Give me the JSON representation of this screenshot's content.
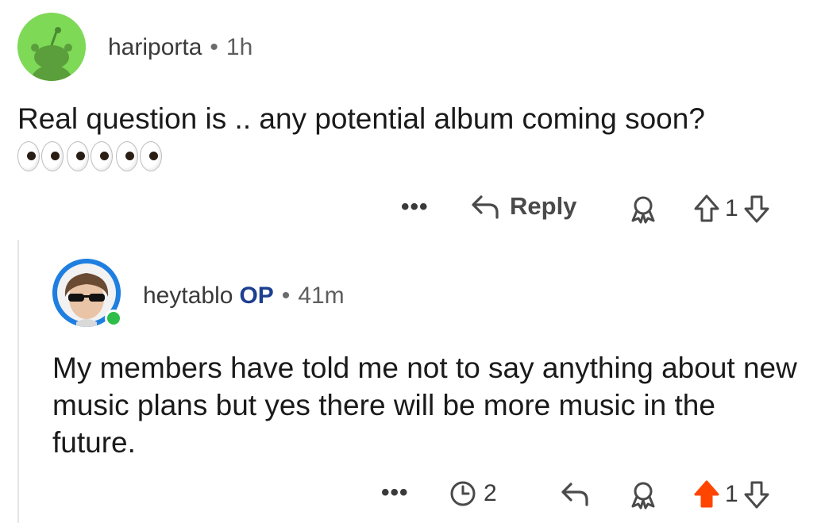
{
  "comment1": {
    "username": "hariporta",
    "separator": "•",
    "time": "1h",
    "text": "Real question is .. any potential album coming soon?",
    "emoji": [
      "eyes",
      "eyes",
      "eyes"
    ],
    "actions": {
      "more_label": "•••",
      "reply_label": "Reply",
      "vote_count": "1"
    }
  },
  "comment2": {
    "username": "heytablo",
    "op_badge": "OP",
    "separator": "•",
    "time": "41m",
    "text": "My members have told me not to say anything about new music plans but yes there will be more music in the future.",
    "actions": {
      "more_label": "•••",
      "timer_count": "2",
      "vote_count": "1",
      "upvoted": true
    }
  },
  "colors": {
    "avatar_green": "#7ed957",
    "avatar_blue": "#1f7fe0",
    "upvote_active": "#ff4500",
    "op_blue": "#1d3f8f",
    "online_green": "#2fbd4a"
  }
}
